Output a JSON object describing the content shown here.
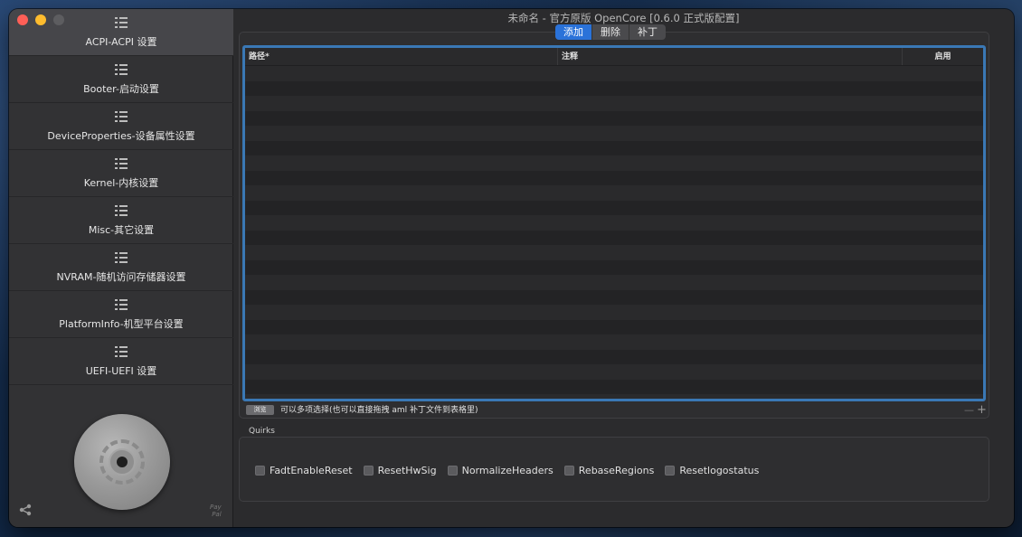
{
  "window": {
    "title": "未命名 - 官方原版 OpenCore [0.6.0 正式版配置]"
  },
  "sidebar": {
    "items": [
      {
        "label": "ACPI-ACPI 设置",
        "active": true
      },
      {
        "label": "Booter-启动设置",
        "active": false
      },
      {
        "label": "DeviceProperties-设备属性设置",
        "active": false
      },
      {
        "label": "Kernel-内核设置",
        "active": false
      },
      {
        "label": "Misc-其它设置",
        "active": false
      },
      {
        "label": "NVRAM-随机访问存储器设置",
        "active": false
      },
      {
        "label": "PlatformInfo-机型平台设置",
        "active": false
      },
      {
        "label": "UEFI-UEFI 设置",
        "active": false
      }
    ],
    "paypal_label": "Pay\nPal",
    "nav_icon": "list-icon",
    "share_icon": "share-icon"
  },
  "tabs": {
    "items": [
      {
        "label": "添加",
        "selected": true
      },
      {
        "label": "删除",
        "selected": false
      },
      {
        "label": "补丁",
        "selected": false
      }
    ],
    "accent": "#2a72d9"
  },
  "table": {
    "columns": [
      "路径*",
      "注释",
      "启用"
    ],
    "rows": [],
    "border_color": "#3a78b5"
  },
  "bottom_bar": {
    "browse_label": "浏览",
    "hint": "可以多项选择(也可以直接拖拽 aml 补丁文件到表格里)",
    "minus_label": "—",
    "plus_label": "+"
  },
  "quirks": {
    "title": "Quirks",
    "items": [
      {
        "label": "FadtEnableReset",
        "checked": false
      },
      {
        "label": "ResetHwSig",
        "checked": false
      },
      {
        "label": "NormalizeHeaders",
        "checked": false
      },
      {
        "label": "RebaseRegions",
        "checked": false
      },
      {
        "label": "Resetlogostatus",
        "checked": false
      }
    ]
  }
}
